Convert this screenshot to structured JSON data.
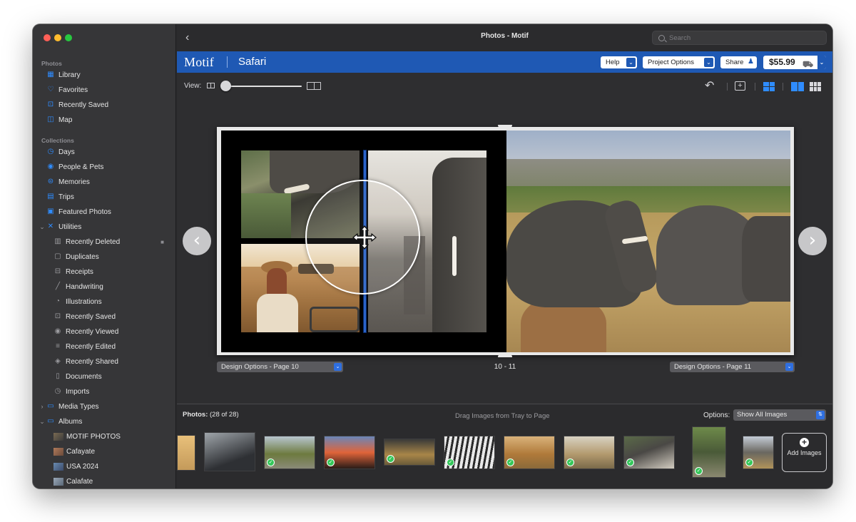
{
  "window": {
    "title": "Photos - Motif"
  },
  "search": {
    "placeholder": "Search"
  },
  "sidebar": {
    "sections": [
      {
        "label": "Photos"
      },
      {
        "label": "Collections"
      }
    ],
    "items": [
      {
        "label": "Library",
        "icon": "library-icon"
      },
      {
        "label": "Favorites",
        "icon": "heart-icon"
      },
      {
        "label": "Recently Saved",
        "icon": "download-icon"
      },
      {
        "label": "Map",
        "icon": "map-icon"
      },
      {
        "label": "Days",
        "icon": "clock-icon"
      },
      {
        "label": "People & Pets",
        "icon": "person-icon"
      },
      {
        "label": "Memories",
        "icon": "memories-icon"
      },
      {
        "label": "Trips",
        "icon": "suitcase-icon"
      },
      {
        "label": "Featured Photos",
        "icon": "featured-icon"
      },
      {
        "label": "Utilities",
        "icon": "utilities-icon"
      },
      {
        "label": "Recently Deleted",
        "icon": "trash-icon"
      },
      {
        "label": "Duplicates",
        "icon": "duplicates-icon"
      },
      {
        "label": "Receipts",
        "icon": "cart-icon"
      },
      {
        "label": "Handwriting",
        "icon": "pen-icon"
      },
      {
        "label": "Illustrations",
        "icon": "palette-icon"
      },
      {
        "label": "Recently Saved",
        "icon": "download-icon"
      },
      {
        "label": "Recently Viewed",
        "icon": "eye-icon"
      },
      {
        "label": "Recently Edited",
        "icon": "sliders-icon"
      },
      {
        "label": "Recently Shared",
        "icon": "share-icon"
      },
      {
        "label": "Documents",
        "icon": "document-icon"
      },
      {
        "label": "Imports",
        "icon": "import-icon"
      },
      {
        "label": "Media Types",
        "icon": "folder-icon"
      },
      {
        "label": "Albums",
        "icon": "folder-icon"
      },
      {
        "label": "MOTIF PHOTOS",
        "icon": "album-thumb"
      },
      {
        "label": "Cafayate",
        "icon": "album-thumb"
      },
      {
        "label": "USA 2024",
        "icon": "album-thumb"
      },
      {
        "label": "Calafate",
        "icon": "album-thumb"
      }
    ]
  },
  "header": {
    "brand": "Motif",
    "project": "Safari",
    "help": "Help",
    "project_options": "Project Options",
    "share": "Share",
    "price": "$55.99"
  },
  "view": {
    "label": "View:"
  },
  "spread": {
    "left_design": "Design Options - Page 10",
    "right_design": "Design Options - Page 11",
    "page_numbers": "10 - 11"
  },
  "tray": {
    "photos_label": "Photos:",
    "photos_count": "(28 of 28)",
    "hint": "Drag Images from Tray to Page",
    "options_label": "Options:",
    "options_value": "Show All Images",
    "add_images": "Add Images"
  },
  "colors": {
    "accent_blue": "#1f59b4",
    "check_green": "#34c759",
    "sidebar_bg": "#363638"
  }
}
